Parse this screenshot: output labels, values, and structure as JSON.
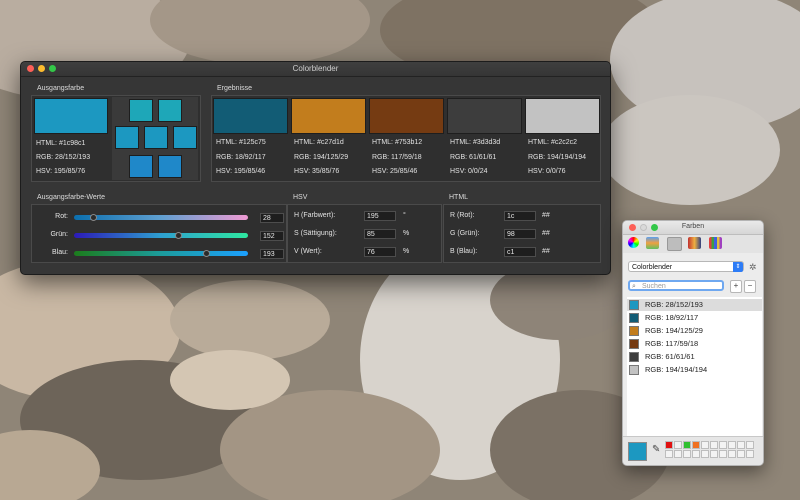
{
  "app": {
    "title": "Colorblender"
  },
  "sections": {
    "source": "Ausgangsfarbe",
    "results": "Ergebnisse",
    "values": "Ausgangsfarbe-Werte",
    "hsv": "HSV",
    "html": "HTML"
  },
  "source_color": {
    "hex": "#1c98c1",
    "html": "HTML: #1c98c1",
    "rgb": "RGB: 28/152/193",
    "hsv": "HSV: 195/85/76"
  },
  "source_variants": [
    "#1ea7b8",
    "#1ea7b8",
    "#1c98c1",
    "#1c98c1",
    "#1c98c1",
    "#1f88c9",
    "#1f88c9"
  ],
  "results": [
    {
      "hex": "#125c75",
      "html": "HTML: #125c75",
      "rgb": "RGB: 18/92/117",
      "hsv": "HSV: 195/85/46"
    },
    {
      "hex": "#c27d1d",
      "html": "HTML: #c27d1d",
      "rgb": "RGB: 194/125/29",
      "hsv": "HSV: 35/85/76"
    },
    {
      "hex": "#753b12",
      "html": "HTML: #753b12",
      "rgb": "RGB: 117/59/18",
      "hsv": "HSV: 25/85/46"
    },
    {
      "hex": "#3d3d3d",
      "html": "HTML: #3d3d3d",
      "rgb": "RGB: 61/61/61",
      "hsv": "HSV: 0/0/24"
    },
    {
      "hex": "#c2c2c2",
      "html": "HTML: #c2c2c2",
      "rgb": "RGB: 194/194/194",
      "hsv": "HSV: 0/0/76"
    }
  ],
  "sliders": [
    {
      "label": "Rot:",
      "value": "28",
      "fraction": 0.11,
      "gradient": "linear-gradient(90deg,#0b6fae,#5f9fd0,#ef9ad2)"
    },
    {
      "label": "Grün:",
      "value": "152",
      "fraction": 0.6,
      "gradient": "linear-gradient(90deg,#2c1ab8,#2ea0d0,#2ee8a0)"
    },
    {
      "label": "Blau:",
      "value": "193",
      "fraction": 0.76,
      "gradient": "linear-gradient(90deg,#1c7c1c,#1c9c9c,#1ca0ff)"
    }
  ],
  "hsv_fields": [
    {
      "label": "H (Farbwert):",
      "value": "195",
      "unit": "°"
    },
    {
      "label": "S (Sättigung):",
      "value": "85",
      "unit": "%"
    },
    {
      "label": "V (Wert):",
      "value": "76",
      "unit": "%"
    }
  ],
  "html_fields": [
    {
      "label": "R (Rot):",
      "value": "1c",
      "unit": "##"
    },
    {
      "label": "G (Grün):",
      "value": "98",
      "unit": "##"
    },
    {
      "label": "B (Blau):",
      "value": "c1",
      "unit": "##"
    }
  ],
  "farben": {
    "title": "Farben",
    "palette": "Colorblender",
    "search_placeholder": "Suchen",
    "plus": "+",
    "minus": "−",
    "items": [
      {
        "label": "RGB: 28/152/193",
        "hex": "#1c98c1"
      },
      {
        "label": "RGB: 18/92/117",
        "hex": "#125c75"
      },
      {
        "label": "RGB: 194/125/29",
        "hex": "#c27d1d"
      },
      {
        "label": "RGB: 117/59/18",
        "hex": "#753b12"
      },
      {
        "label": "RGB: 61/61/61",
        "hex": "#3d3d3d"
      },
      {
        "label": "RGB: 194/194/194",
        "hex": "#c2c2c2"
      }
    ],
    "current_color": "#1c98c1"
  }
}
